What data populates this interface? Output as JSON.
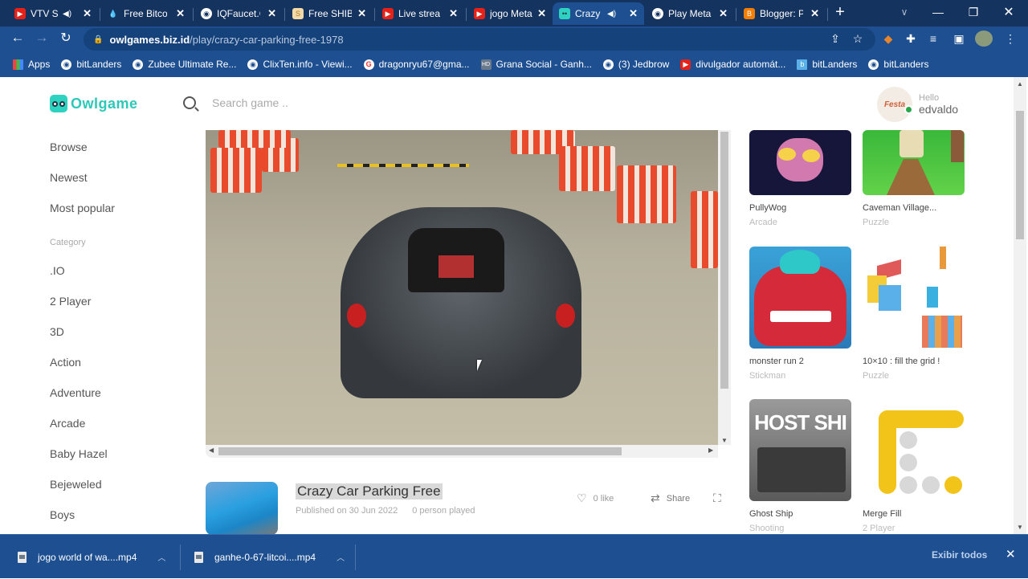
{
  "browser": {
    "tabs": [
      {
        "title": "VTV SI",
        "favicon": "youtube-icon",
        "audio": true
      },
      {
        "title": "Free Bitcoi",
        "favicon": "drop-icon"
      },
      {
        "title": "IQFaucet.C",
        "favicon": "globe-icon"
      },
      {
        "title": "Free SHIB",
        "favicon": "shib-icon"
      },
      {
        "title": "Live strea",
        "favicon": "youtube-icon"
      },
      {
        "title": "jogo Meta",
        "favicon": "youtube-icon"
      },
      {
        "title": "Crazy",
        "favicon": "owl-icon",
        "audio": true,
        "active": true
      },
      {
        "title": "Play Meta",
        "favicon": "globe-icon"
      },
      {
        "title": "Blogger: P",
        "favicon": "blogger-icon"
      }
    ],
    "new_tab": "+",
    "url_host": "owlgames.biz.id",
    "url_path": "/play/crazy-car-parking-free-1978",
    "bookmarks": [
      {
        "label": "Apps",
        "icon": "apps-grid-icon"
      },
      {
        "label": "bitLanders",
        "icon": "globe-icon"
      },
      {
        "label": "Zubee Ultimate Re...",
        "icon": "globe-icon"
      },
      {
        "label": "ClixTen.info - Viewi...",
        "icon": "globe-icon"
      },
      {
        "label": "dragonryu67@gma...",
        "icon": "google-icon"
      },
      {
        "label": "Grana Social - Ganh...",
        "icon": "hd-icon"
      },
      {
        "label": "(3) Jedbrow",
        "icon": "globe-icon"
      },
      {
        "label": "divulgador automát...",
        "icon": "youtube-icon"
      },
      {
        "label": "bitLanders",
        "icon": "bitlanders-icon"
      },
      {
        "label": "bitLanders",
        "icon": "globe-icon"
      }
    ]
  },
  "site": {
    "logo": "Owlgame",
    "search_placeholder": "Search game ..",
    "user": {
      "greeting": "Hello",
      "name": "edvaldo",
      "avatar_text": "Festa"
    },
    "nav": [
      "Browse",
      "Newest",
      "Most popular"
    ],
    "category_heading": "Category",
    "categories": [
      ".IO",
      "2 Player",
      "3D",
      "Action",
      "Adventure",
      "Arcade",
      "Baby Hazel",
      "Bejeweled",
      "Boys"
    ]
  },
  "game": {
    "title": "Crazy Car Parking Free",
    "published": "Published on 30 Jun 2022",
    "played": "0 person played",
    "likes": "0 like",
    "share": "Share"
  },
  "related": [
    {
      "title": "PullyWog",
      "category": "Arcade"
    },
    {
      "title": "Caveman Village...",
      "category": "Puzzle"
    },
    {
      "title": "monster run 2",
      "category": "Stickman"
    },
    {
      "title": "10×10 : fill the grid !",
      "category": "Puzzle"
    },
    {
      "title": "Ghost Ship",
      "category": "Shooting"
    },
    {
      "title": "Merge Fill",
      "category": "2 Player"
    }
  ],
  "downloads": {
    "items": [
      "jogo world of  wa....mp4",
      "ganhe-0-67-litcoi....mp4"
    ],
    "show_all": "Exibir todos"
  },
  "colors": {
    "brand": "#2dc8b8",
    "chrome": "#1d4f91",
    "tabstrip": "#14335f"
  }
}
